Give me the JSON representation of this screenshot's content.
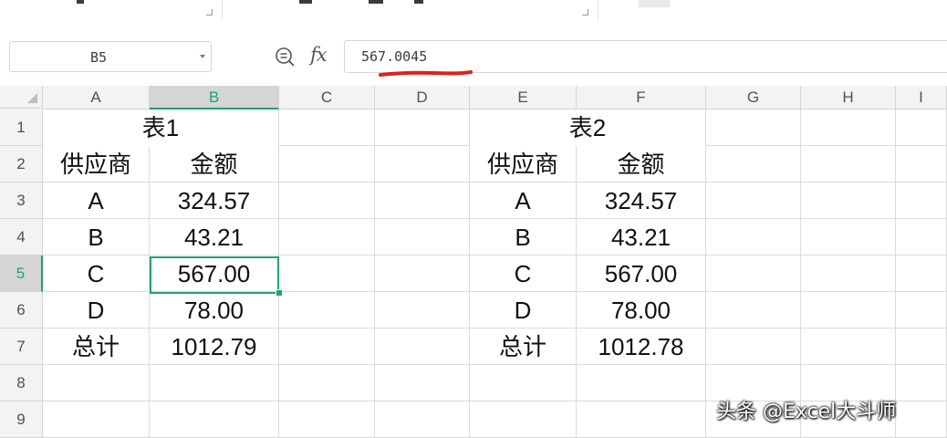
{
  "name_box": {
    "value": "B5"
  },
  "formula_bar": {
    "fx_label": "fx",
    "value": "567.0045"
  },
  "columns": [
    "A",
    "B",
    "C",
    "D",
    "E",
    "F",
    "G",
    "H",
    "I"
  ],
  "rows": [
    "1",
    "2",
    "3",
    "4",
    "5",
    "6",
    "7",
    "8",
    "9"
  ],
  "active_cell": {
    "column": "B",
    "row": "5"
  },
  "sheet": {
    "A1": "表1",
    "B1": "",
    "A2": "供应商",
    "B2": "金额",
    "A3": "A",
    "B3": "324.57",
    "A4": "B",
    "B4": "43.21",
    "A5": "C",
    "B5": "567.00",
    "A6": "D",
    "B6": "78.00",
    "A7": "总计",
    "B7": "1012.79",
    "E1": "表2",
    "F1": "",
    "E2": "供应商",
    "F2": "金额",
    "E3": "A",
    "F3": "324.57",
    "E4": "B",
    "F4": "43.21",
    "E5": "C",
    "F5": "567.00",
    "E6": "D",
    "F6": "78.00",
    "E7": "总计",
    "F7": "1012.78"
  },
  "watermark": "头条 @Excel大斗师",
  "colors": {
    "accent": "#21a366",
    "annotation": "#e0201c",
    "gridline": "#dadada",
    "header_bg": "#f3f3f3"
  }
}
